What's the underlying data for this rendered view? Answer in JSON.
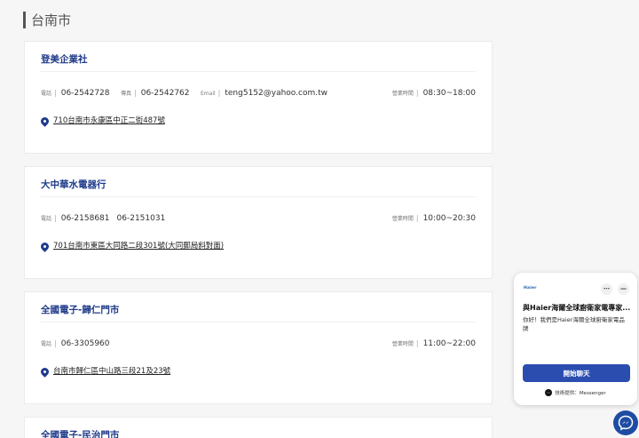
{
  "city": {
    "title": "台南市"
  },
  "labels": {
    "phone": "電話",
    "fax": "傳真",
    "email": "Email",
    "hours": "營業時間",
    "separator": "|"
  },
  "shops": [
    {
      "name": "登美企業社",
      "phone": "06-2542728",
      "fax": "06-2542762",
      "email": "teng5152@yahoo.com.tw",
      "hours": "08:30~18:00",
      "address": "710台南市永康區中正二街487號"
    },
    {
      "name": "大中華水電器行",
      "phone": "06-2158681",
      "phone2": "06-2151031",
      "hours": "10:00~20:30",
      "address": "701台南市東區大同路二段301號(大同郵局斜對面)"
    },
    {
      "name": "全國電子-歸仁門市",
      "phone": "06-3305960",
      "hours": "11:00~22:00",
      "address": "台南市歸仁區中山路三段21及23號"
    },
    {
      "name": "全國電子-民治門市"
    }
  ],
  "chat": {
    "logo": "Haier",
    "more_icon": "⋯",
    "minimize_icon": "—",
    "title": "與Haier海爾全球廚衛家電專家...",
    "message": "你好！我們是Haier海爾全球廚衛家電品牌",
    "start_button": "開始聊天",
    "footer": "技術提供：Messenger"
  },
  "colors": {
    "accent": "#1f3b8a",
    "button": "#2b4db0",
    "messenger": "#1f4ca3"
  }
}
